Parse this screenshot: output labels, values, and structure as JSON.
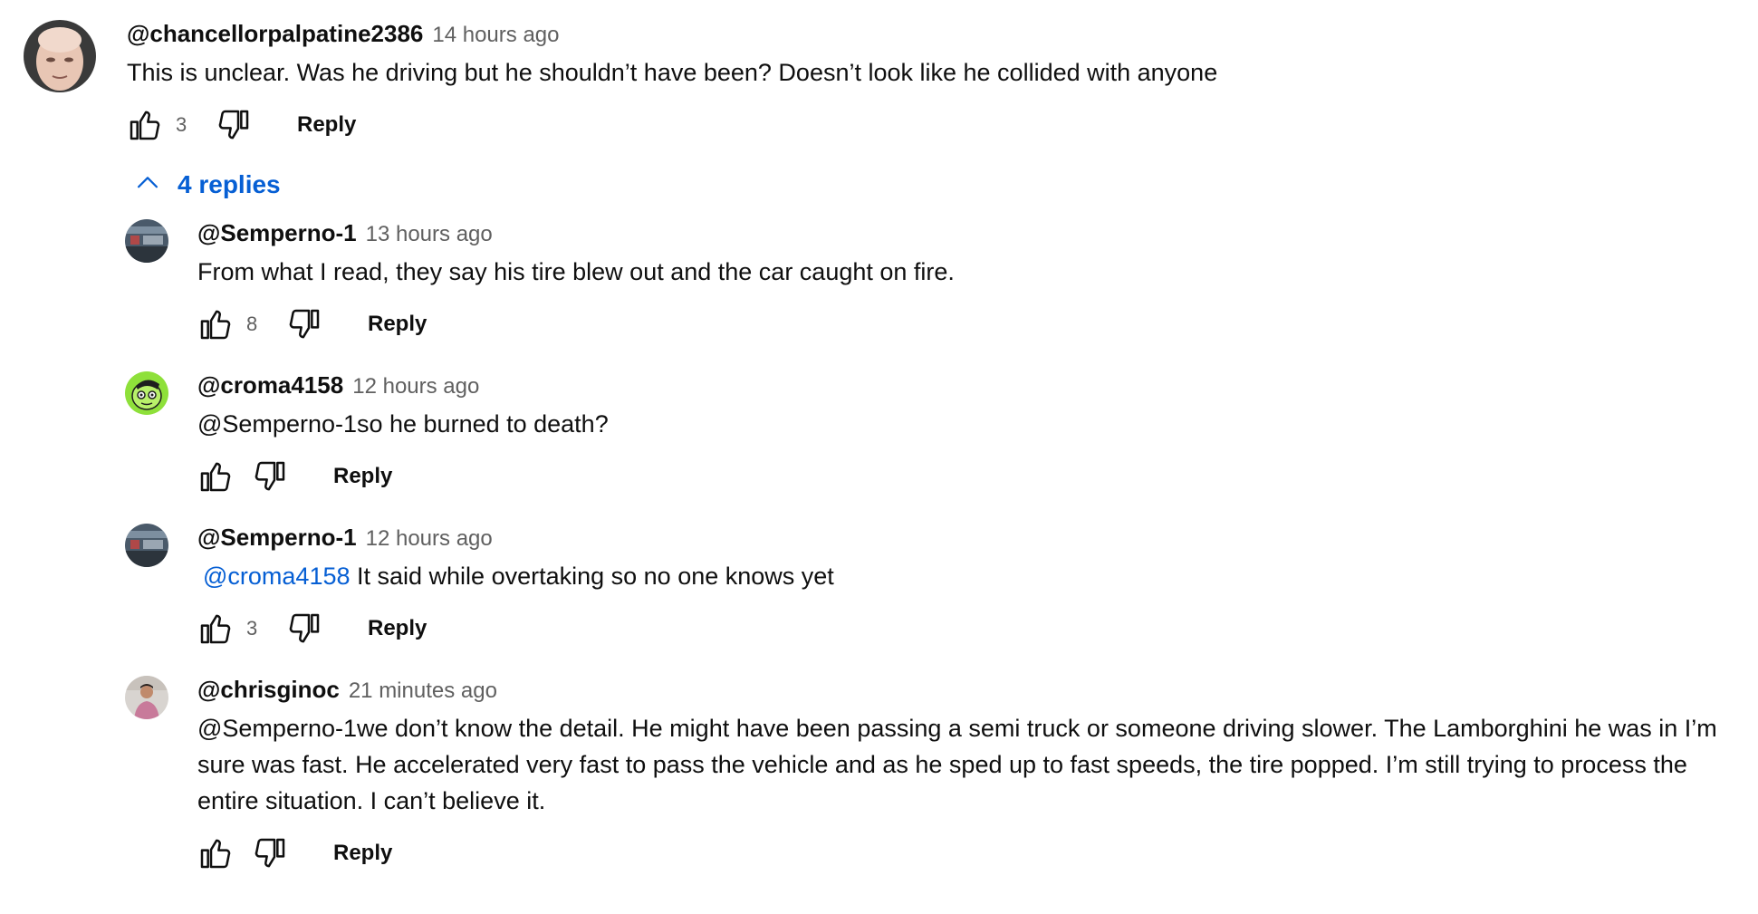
{
  "top_comment": {
    "author": "@chancellorpalpatine2386",
    "time": "14 hours ago",
    "text": "This is unclear. Was he driving but he shouldn’t have been? Doesn’t look like he collided with anyone",
    "likes": "3",
    "reply_label": "Reply"
  },
  "replies_toggle": {
    "label": "4 replies",
    "icon": "chevron-up-icon"
  },
  "replies": [
    {
      "author": "@Semperno-1",
      "time": "13 hours ago",
      "text": "From what I read, they say his tire blew out and the car caught on fire.",
      "likes": "8",
      "reply_label": "Reply"
    },
    {
      "author": "@croma4158",
      "time": "12 hours ago",
      "text": "@Semperno-1so he burned to death?",
      "likes": "",
      "reply_label": "Reply"
    },
    {
      "author": "@Semperno-1",
      "time": "12 hours ago",
      "mention": "@croma4158",
      "text": " It said while overtaking so no one knows yet",
      "likes": "3",
      "reply_label": "Reply"
    },
    {
      "author": "@chrisginoc",
      "time": "21 minutes ago",
      "text": "@Semperno-1we don’t know the detail. He might have been passing a semi truck or someone driving slower. The Lamborghini he was in I’m sure was fast. He accelerated very fast to pass the vehicle and as he sped up to fast speeds, the tire popped. I’m still trying to process the entire situation. I can’t believe it.",
      "likes": "",
      "reply_label": "Reply"
    }
  ],
  "colors": {
    "link": "#065fd4",
    "secondary_text": "#606060",
    "primary_text": "#0f0f0f"
  }
}
